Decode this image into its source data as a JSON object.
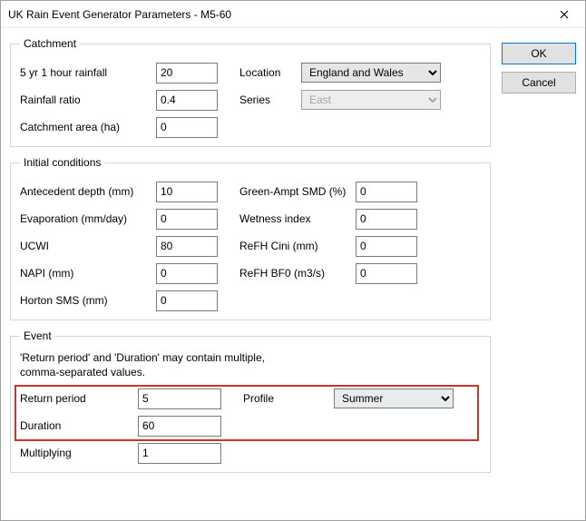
{
  "window": {
    "title": "UK Rain Event Generator Parameters - M5-60"
  },
  "buttons": {
    "ok": "OK",
    "cancel": "Cancel"
  },
  "catchment": {
    "legend": "Catchment",
    "rainfall_label": "5 yr 1 hour rainfall",
    "rainfall_value": "20",
    "ratio_label": "Rainfall ratio",
    "ratio_value": "0.4",
    "area_label": "Catchment area (ha)",
    "area_value": "0",
    "location_label": "Location",
    "location_value": "England and Wales",
    "series_label": "Series",
    "series_value": "East"
  },
  "initial": {
    "legend": "Initial conditions",
    "antecedent_label": "Antecedent depth (mm)",
    "antecedent_value": "10",
    "evap_label": "Evaporation (mm/day)",
    "evap_value": "0",
    "ucwi_label": "UCWI",
    "ucwi_value": "80",
    "napi_label": "NAPI (mm)",
    "napi_value": "0",
    "horton_label": "Horton SMS (mm)",
    "horton_value": "0",
    "ga_label": "Green-Ampt SMD (%)",
    "ga_value": "0",
    "wet_label": "Wetness index",
    "wet_value": "0",
    "cini_label": "ReFH Cini (mm)",
    "cini_value": "0",
    "bf0_label": "ReFH BF0 (m3/s)",
    "bf0_value": "0"
  },
  "event": {
    "legend": "Event",
    "hint": "'Return period' and 'Duration' may contain multiple, comma-separated values.",
    "return_label": "Return period",
    "return_value": "5",
    "duration_label": "Duration",
    "duration_value": "60",
    "mult_label": "Multiplying",
    "mult_value": "1",
    "profile_label": "Profile",
    "profile_value": "Summer"
  }
}
